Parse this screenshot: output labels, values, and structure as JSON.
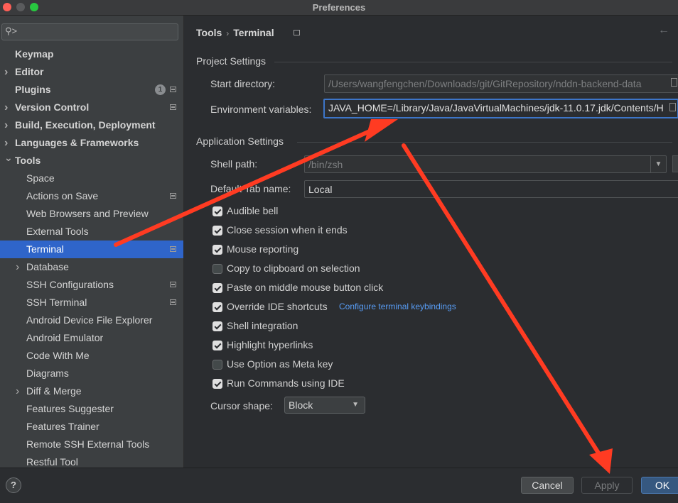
{
  "window": {
    "title": "Preferences"
  },
  "sidebar": {
    "search_placeholder": "",
    "items": [
      {
        "label": "Keymap",
        "level": "top",
        "expandable": false,
        "scope": false
      },
      {
        "label": "Editor",
        "level": "top",
        "expandable": true,
        "scope": false
      },
      {
        "label": "Plugins",
        "level": "top",
        "expandable": false,
        "scope": true,
        "badge": "1"
      },
      {
        "label": "Version Control",
        "level": "top",
        "expandable": true,
        "scope": true
      },
      {
        "label": "Build, Execution, Deployment",
        "level": "top",
        "expandable": true,
        "scope": false
      },
      {
        "label": "Languages & Frameworks",
        "level": "top",
        "expandable": true,
        "scope": false
      },
      {
        "label": "Tools",
        "level": "top",
        "expandable": true,
        "expanded": true,
        "scope": false
      },
      {
        "label": "Space",
        "level": "child",
        "expandable": false,
        "scope": false
      },
      {
        "label": "Actions on Save",
        "level": "child",
        "expandable": false,
        "scope": true
      },
      {
        "label": "Web Browsers and Preview",
        "level": "child",
        "expandable": false,
        "scope": false
      },
      {
        "label": "External Tools",
        "level": "child",
        "expandable": false,
        "scope": false
      },
      {
        "label": "Terminal",
        "level": "child",
        "expandable": false,
        "scope": true,
        "selected": true
      },
      {
        "label": "Database",
        "level": "child",
        "expandable": true,
        "scope": false
      },
      {
        "label": "SSH Configurations",
        "level": "child",
        "expandable": false,
        "scope": true
      },
      {
        "label": "SSH Terminal",
        "level": "child",
        "expandable": false,
        "scope": true
      },
      {
        "label": "Android Device File Explorer",
        "level": "child",
        "expandable": false,
        "scope": false
      },
      {
        "label": "Android Emulator",
        "level": "child",
        "expandable": false,
        "scope": false
      },
      {
        "label": "Code With Me",
        "level": "child",
        "expandable": false,
        "scope": false
      },
      {
        "label": "Diagrams",
        "level": "child",
        "expandable": false,
        "scope": false
      },
      {
        "label": "Diff & Merge",
        "level": "child",
        "expandable": true,
        "scope": false
      },
      {
        "label": "Features Suggester",
        "level": "child",
        "expandable": false,
        "scope": false
      },
      {
        "label": "Features Trainer",
        "level": "child",
        "expandable": false,
        "scope": false
      },
      {
        "label": "Remote SSH External Tools",
        "level": "child",
        "expandable": false,
        "scope": false
      },
      {
        "label": "Restful Tool",
        "level": "child",
        "expandable": false,
        "scope": false
      }
    ]
  },
  "breadcrumb": {
    "parent": "Tools",
    "current": "Terminal"
  },
  "project_settings": {
    "title": "Project Settings",
    "start_directory_label": "Start directory:",
    "start_directory_value": "/Users/wangfengchen/Downloads/git/GitRepository/nddn-backend-data",
    "env_vars_label": "Environment variables:",
    "env_vars_value": "JAVA_HOME=/Library/Java/JavaVirtualMachines/jdk-11.0.17.jdk/Contents/H"
  },
  "application_settings": {
    "title": "Application Settings",
    "shell_path_label": "Shell path:",
    "shell_path_value": "/bin/zsh",
    "tab_name_label": "Default Tab name:",
    "tab_name_value": "Local",
    "checkboxes": [
      {
        "label": "Audible bell",
        "checked": true
      },
      {
        "label": "Close session when it ends",
        "checked": true
      },
      {
        "label": "Mouse reporting",
        "checked": true
      },
      {
        "label": "Copy to clipboard on selection",
        "checked": false
      },
      {
        "label": "Paste on middle mouse button click",
        "checked": true
      },
      {
        "label": "Override IDE shortcuts",
        "checked": true,
        "link": "Configure terminal keybindings"
      },
      {
        "label": "Shell integration",
        "checked": true
      },
      {
        "label": "Highlight hyperlinks",
        "checked": true
      },
      {
        "label": "Use Option as Meta key",
        "checked": false
      },
      {
        "label": "Run Commands using IDE",
        "checked": true
      }
    ],
    "cursor_shape_label": "Cursor shape:",
    "cursor_shape_value": "Block"
  },
  "footer": {
    "help": "?",
    "cancel": "Cancel",
    "apply": "Apply",
    "ok": "OK"
  },
  "colors": {
    "selection": "#2f65ca",
    "annotation": "#ff3b22",
    "link": "#589df6"
  }
}
